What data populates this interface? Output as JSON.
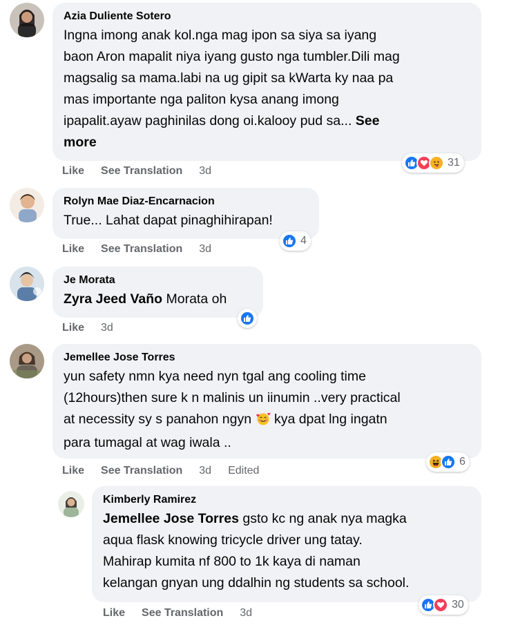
{
  "actions": {
    "like": "Like",
    "see_translation": "See Translation",
    "edited": "Edited"
  },
  "comments": [
    {
      "author": "Azia Duliente Sotero",
      "lines": [
        "Ingna imong anak kol.nga mag ipon sa siya sa iyang",
        "baon Aron mapalit niya iyang gusto nga tumbler.Dili mag",
        "magsalig sa mama.labi na ug gipit sa kWarta ky naa pa",
        "mas importante nga paliton kysa anang imong",
        "ipapalit.ayaw paghinilas dong oi.kalooy pud sa..."
      ],
      "see_more_1": "See",
      "see_more_2": "more",
      "time": "3d",
      "reaction_count": "31",
      "reaction_icons": [
        "like-icon",
        "love-icon",
        "care-icon"
      ]
    },
    {
      "author": "Rolyn Mae Diaz-Encarnacion",
      "text": "True... Lahat dapat pinaghihirapan!",
      "time": "3d",
      "reaction_count": "4",
      "reaction_icons": [
        "like-icon"
      ]
    },
    {
      "author": "Je Morata",
      "mention": "Zyra Jeed Vaño",
      "text": " Morata oh",
      "time": "3d",
      "reaction_icons": [
        "like-icon"
      ]
    },
    {
      "author": "Jemellee Jose Torres",
      "lines": [
        "yun safety nmn kya need nyn tgal ang cooling time",
        "(12hours)then sure k n malinis un iinumin ..very practical",
        "at necessity sy s panahon ngyn",
        "kya dpat lng ingatn",
        "para tumagal at wag iwala .."
      ],
      "emoji": "smiling-face-with-hearts-emoji",
      "time": "3d",
      "reaction_count": "6",
      "reaction_icons": [
        "haha-icon",
        "like-icon"
      ]
    },
    {
      "author": "Kimberly Ramirez",
      "mention": "Jemellee Jose Torres",
      "lines": [
        " gsto kc ng anak nya magka",
        "aqua flask knowing tricycle driver ung tatay.",
        "Mahirap kumita nf 800 to 1k kaya di naman",
        "kelangan gnyan ung ddalhin ng students sa school."
      ],
      "time": "3d",
      "reaction_count": "30",
      "reaction_icons": [
        "like-icon",
        "love-icon"
      ]
    }
  ],
  "colors": {
    "bubble": "#f0f2f5",
    "meta": "#65676b",
    "like": "#1877f2",
    "love": "#f33e58",
    "care": "#f7b125"
  }
}
